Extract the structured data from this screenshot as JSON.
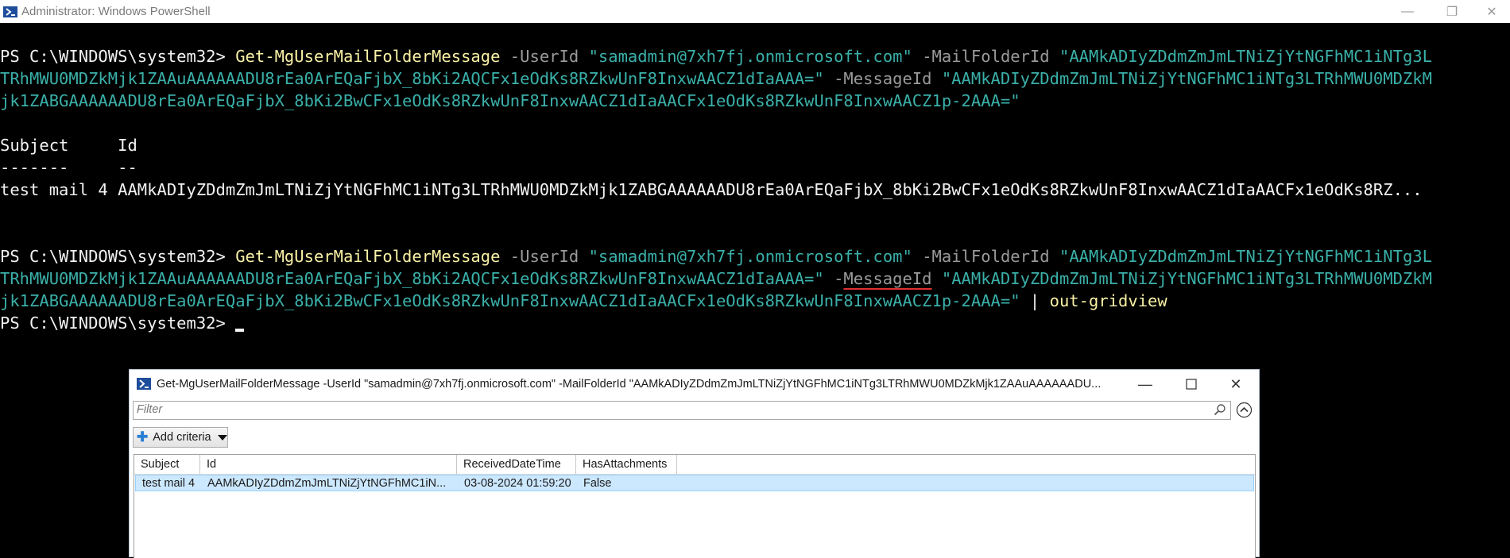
{
  "window": {
    "title": "Administrator: Windows PowerShell",
    "controls": {
      "minimize": "—",
      "restore": "❐",
      "close": "✕"
    }
  },
  "console": {
    "prompt": "PS C:\\WINDOWS\\system32> ",
    "cmd1": {
      "cmdlet": "Get-MgUserMailFolderMessage",
      "p_userid": " -UserId ",
      "v_userid": "\"samadmin@7xh7fj.onmicrosoft.com\"",
      "p_folder": " -MailFolderId ",
      "v_folder_a": "\"AAMkADIyZDdmZmJmLTNiZjYtNGFhMC1iNTg3L",
      "v_folder_b": "TRhMWU0MDZkMjk1ZAAuAAAAAADU8rEa0ArEQaFjbX_8bKi2AQCFx1eOdKs8RZkwUnF8InxwAACZ1dIaAAA=\"",
      "p_msg": " -MessageId ",
      "v_msg_a": "\"AAMkADIyZDdmZmJmLTNiZjYtNGFhMC1iNTg3LTRhMWU0MDZkM",
      "v_msg_b": "jk1ZABGAAAAAADU8rEa0ArEQaFjbX_8bKi2BwCFx1eOdKs8RZkwUnF8InxwAACZ1dIaAACFx1eOdKs8RZkwUnF8InxwAACZ1p-2AAA=\""
    },
    "output": {
      "header": "Subject     Id",
      "underline": "-------     --",
      "row": "test mail 4 AAMkADIyZDdmZmJmLTNiZjYtNGFhMC1iNTg3LTRhMWU0MDZkMjk1ZABGAAAAAADU8rEa0ArEQaFjbX_8bKi2BwCFx1eOdKs8RZkwUnF8InxwAACZ1dIaAACFx1eOdKs8RZ..."
    },
    "cmd2": {
      "dash": " -",
      "msg_word": "MessageId",
      "sp": " ",
      "v_msg_a": "\"AAMkADIyZDdmZmJmLTNiZjYtNGFhMC1iNTg3LTRhMWU0MDZkM",
      "pipe": " | ",
      "out": "out-gridview"
    }
  },
  "gridview": {
    "title": "Get-MgUserMailFolderMessage -UserId \"samadmin@7xh7fj.onmicrosoft.com\" -MailFolderId \"AAMkADIyZDdmZmJmLTNiZjYtNGFhMC1iNTg3LTRhMWU0MDZkMjk1ZAAuAAAAAADU...",
    "filter_placeholder": "Filter",
    "add_criteria": "Add criteria",
    "columns": [
      "Subject",
      "Id",
      "ReceivedDateTime",
      "HasAttachments"
    ],
    "rows": [
      [
        "test mail 4",
        "AAMkADIyZDdmZmJmLTNiZjYtNGFhMC1iN...",
        "03-08-2024 01:59:20",
        "False"
      ]
    ]
  }
}
